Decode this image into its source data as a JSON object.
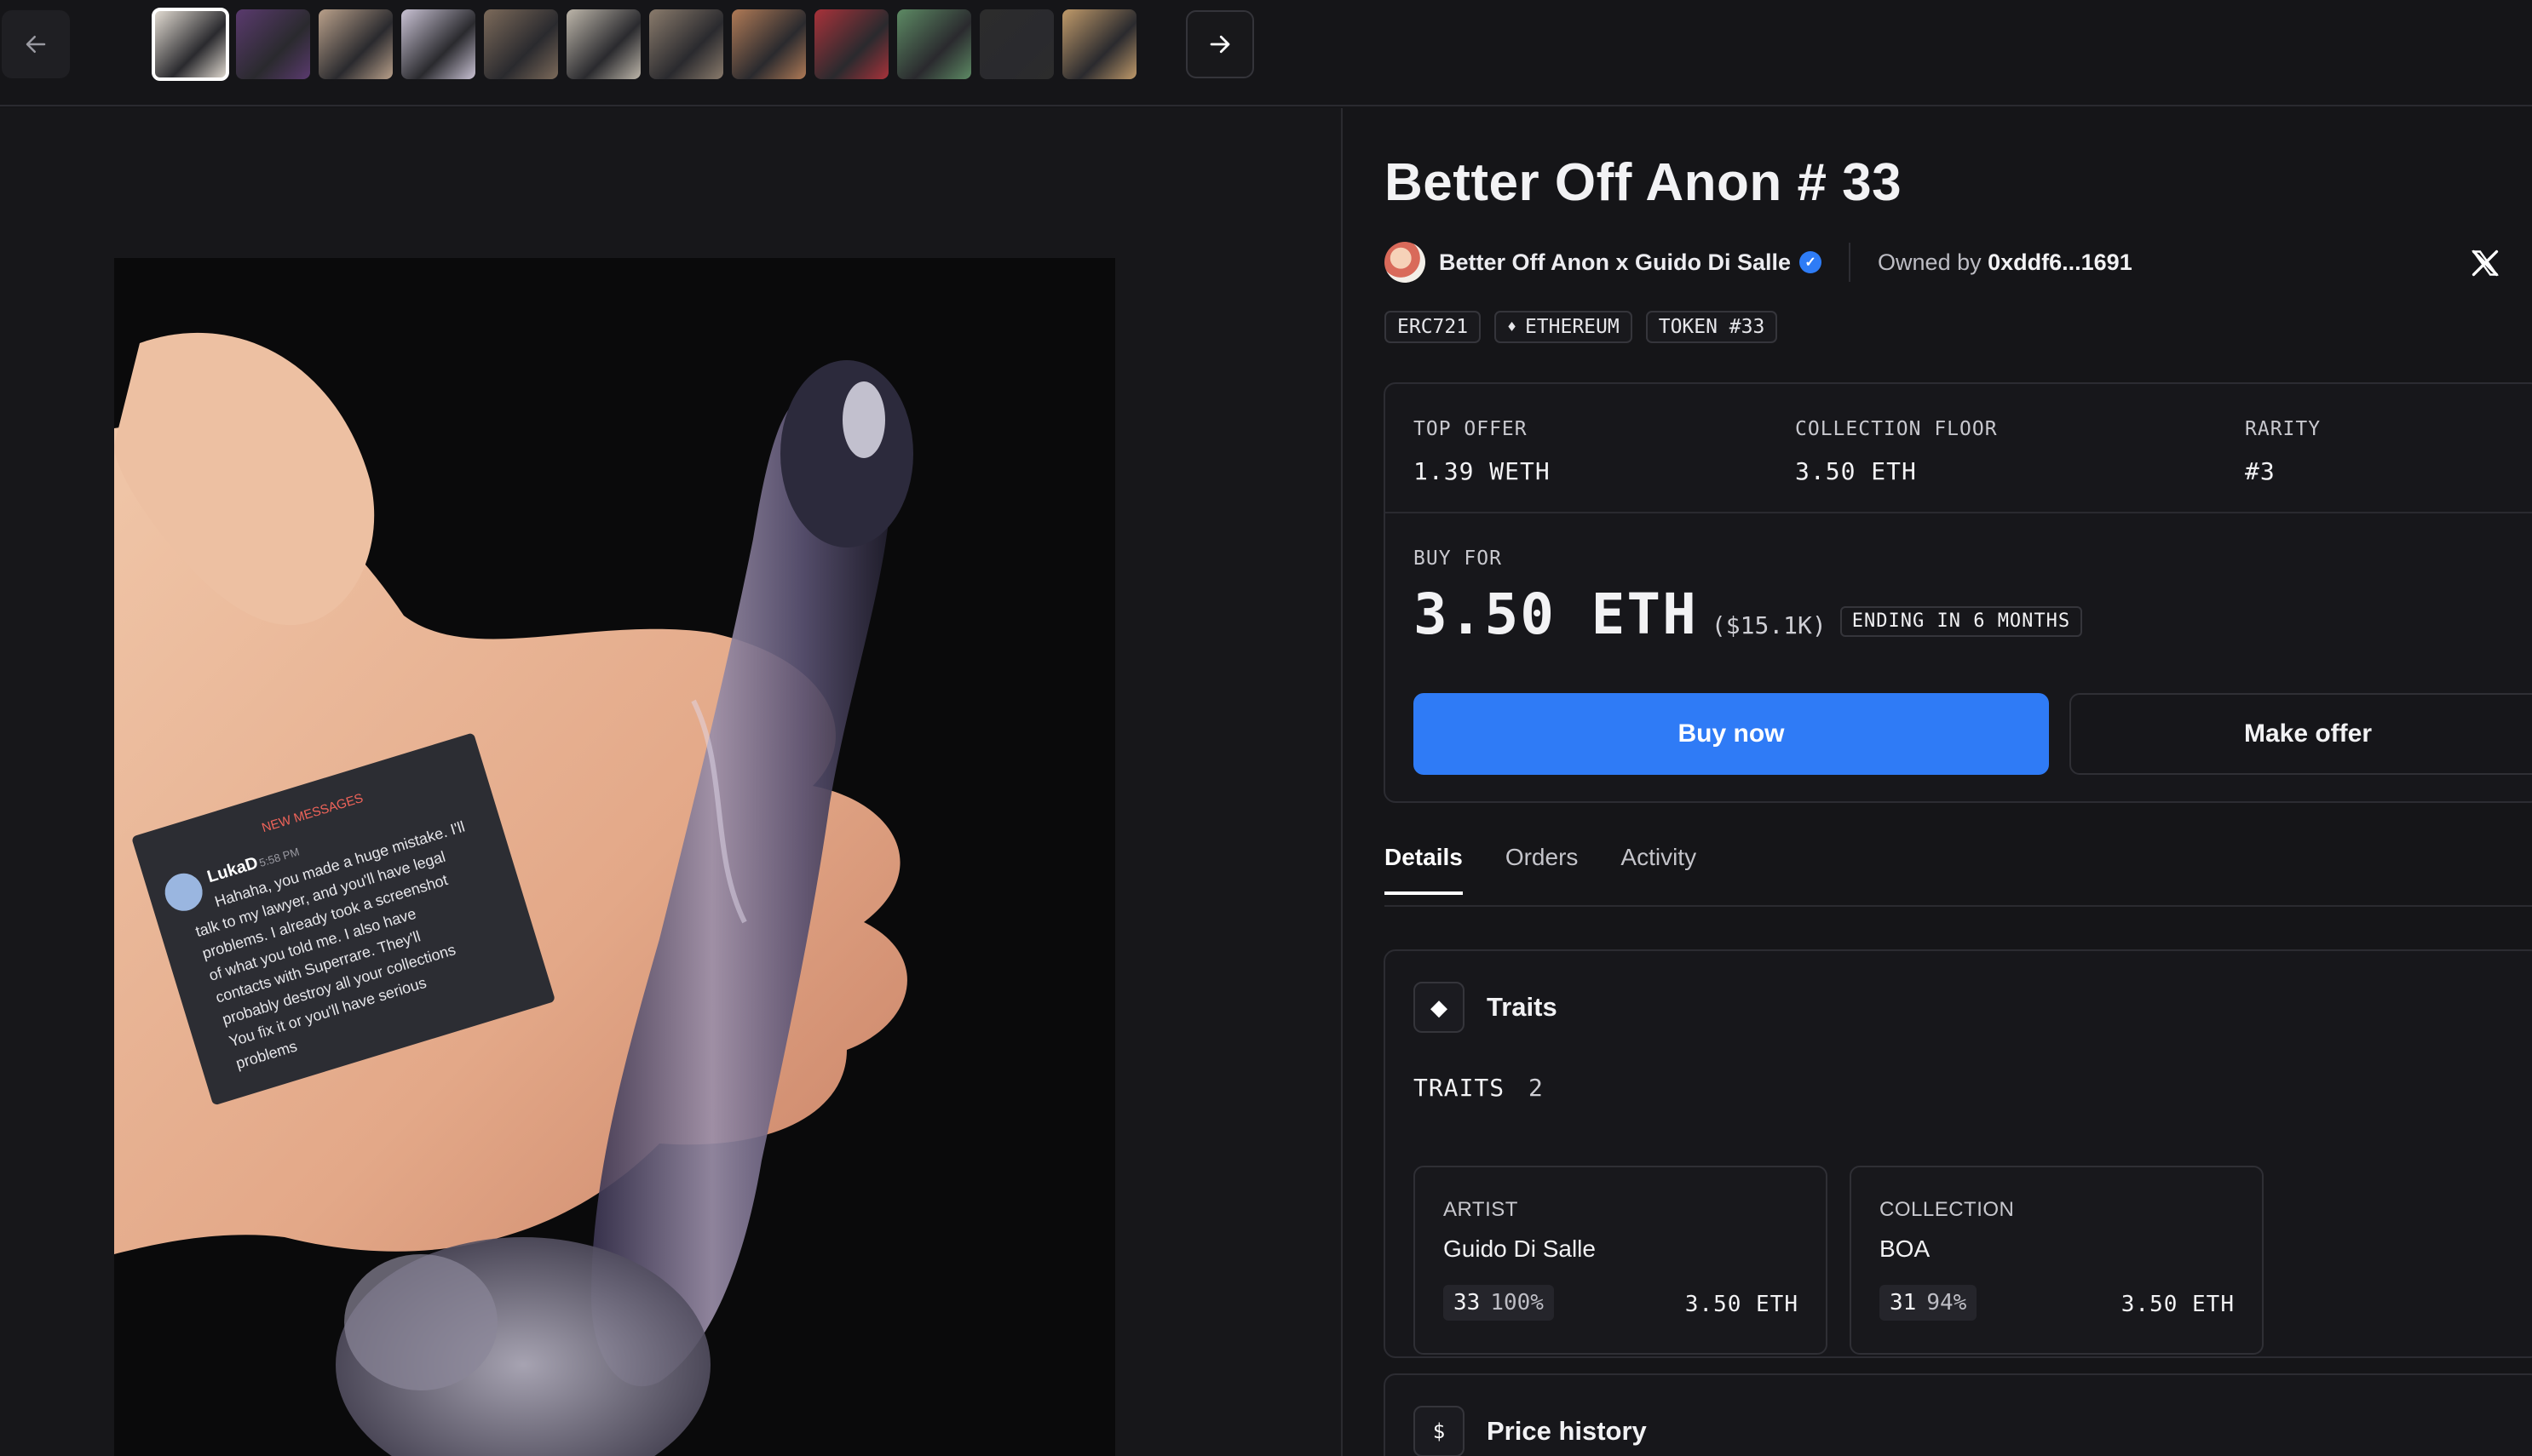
{
  "thumbnails": {
    "count": 12,
    "colors": [
      "#e9e2d8",
      "#5a3a6e",
      "#b9a08a",
      "#c9c2d4",
      "#7c6a5a",
      "#bdb6aa",
      "#8a7b6c",
      "#b07a56",
      "#a8323a",
      "#5d8a64",
      "#2c2c2c",
      "#c09a6a"
    ]
  },
  "item": {
    "title": "Better Off Anon # 33",
    "collection": "Better Off Anon x Guido Di Salle",
    "owned_prefix": "Owned by",
    "owner": "0xddf6...1691",
    "badges": [
      "ERC721",
      "ETHEREUM",
      "TOKEN #33"
    ]
  },
  "artwork": {
    "card_header": "NEW MESSAGES",
    "card_user": "LukaD",
    "card_time": "5:58 PM",
    "card_lines": [
      "Hahaha, you made a huge mistake. I'll",
      "talk to my lawyer, and you'll have legal",
      "problems. I already took a screenshot",
      "of what you told me. I also have",
      "contacts with Superrare. They'll",
      "probably destroy all your collections",
      "You fix it or you'll have serious",
      "problems"
    ]
  },
  "offer": {
    "top_offer_label": "TOP OFFER",
    "top_offer_value": "1.39 WETH",
    "floor_label": "COLLECTION FLOOR",
    "floor_value": "3.50 ETH",
    "rarity_label": "RARITY",
    "rarity_value": "#3",
    "buy_for_label": "BUY FOR",
    "price": "3.50 ETH",
    "usd": "($15.1K)",
    "ending": "ENDING IN 6 MONTHS",
    "buy_button": "Buy now",
    "offer_button": "Make offer"
  },
  "tabs": [
    "Details",
    "Orders",
    "Activity"
  ],
  "traits": {
    "section_title": "Traits",
    "count_label": "TRAITS",
    "count": "2",
    "items": [
      {
        "type": "ARTIST",
        "value": "Guido Di Salle",
        "count": "33",
        "pct": "100%",
        "floor": "3.50 ETH"
      },
      {
        "type": "COLLECTION",
        "value": "BOA",
        "count": "31",
        "pct": "94%",
        "floor": "3.50 ETH"
      }
    ]
  },
  "price_history": {
    "section_title": "Price history"
  },
  "colors": {
    "accent": "#2f7bf6",
    "background": "#151518",
    "verified": "#2e7cf6"
  }
}
